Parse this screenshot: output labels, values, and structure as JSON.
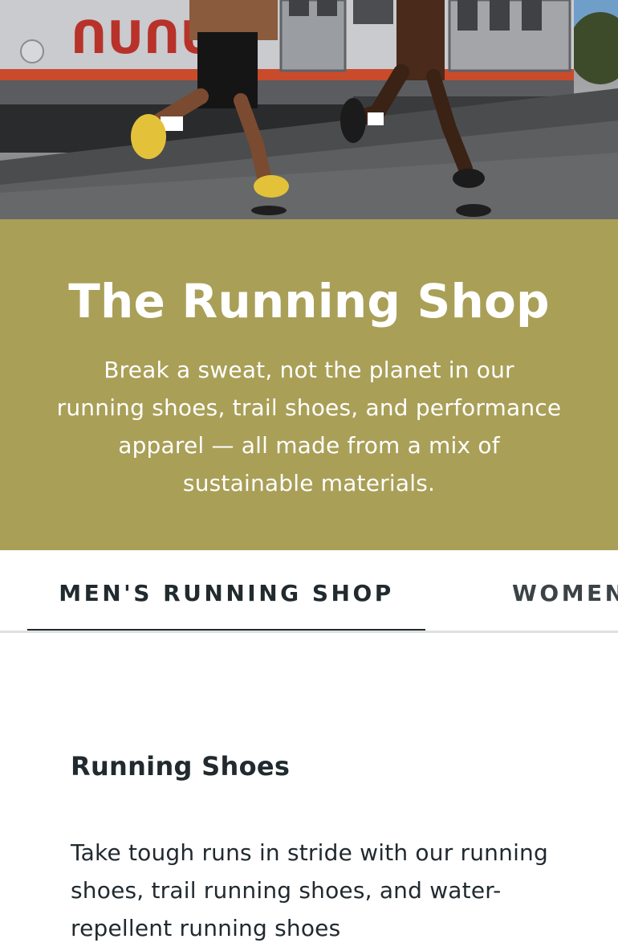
{
  "hero": {
    "train_logo": "ᑎᑌᑎᑌI"
  },
  "banner": {
    "title": "The Running Shop",
    "description": "Break a sweat, not the planet in our running shoes, trail shoes, and performance apparel — all made from a mix of sustainable materials.",
    "background_color": "#a99f57"
  },
  "tabs": [
    {
      "label": "MEN'S RUNNING SHOP",
      "active": true
    },
    {
      "label": "WOMEN'S RUNNING SHOP",
      "active": false
    }
  ],
  "section": {
    "heading": "Running Shoes",
    "body": "Take tough runs in stride with our running shoes, trail running shoes, and water-repellent running shoes"
  }
}
